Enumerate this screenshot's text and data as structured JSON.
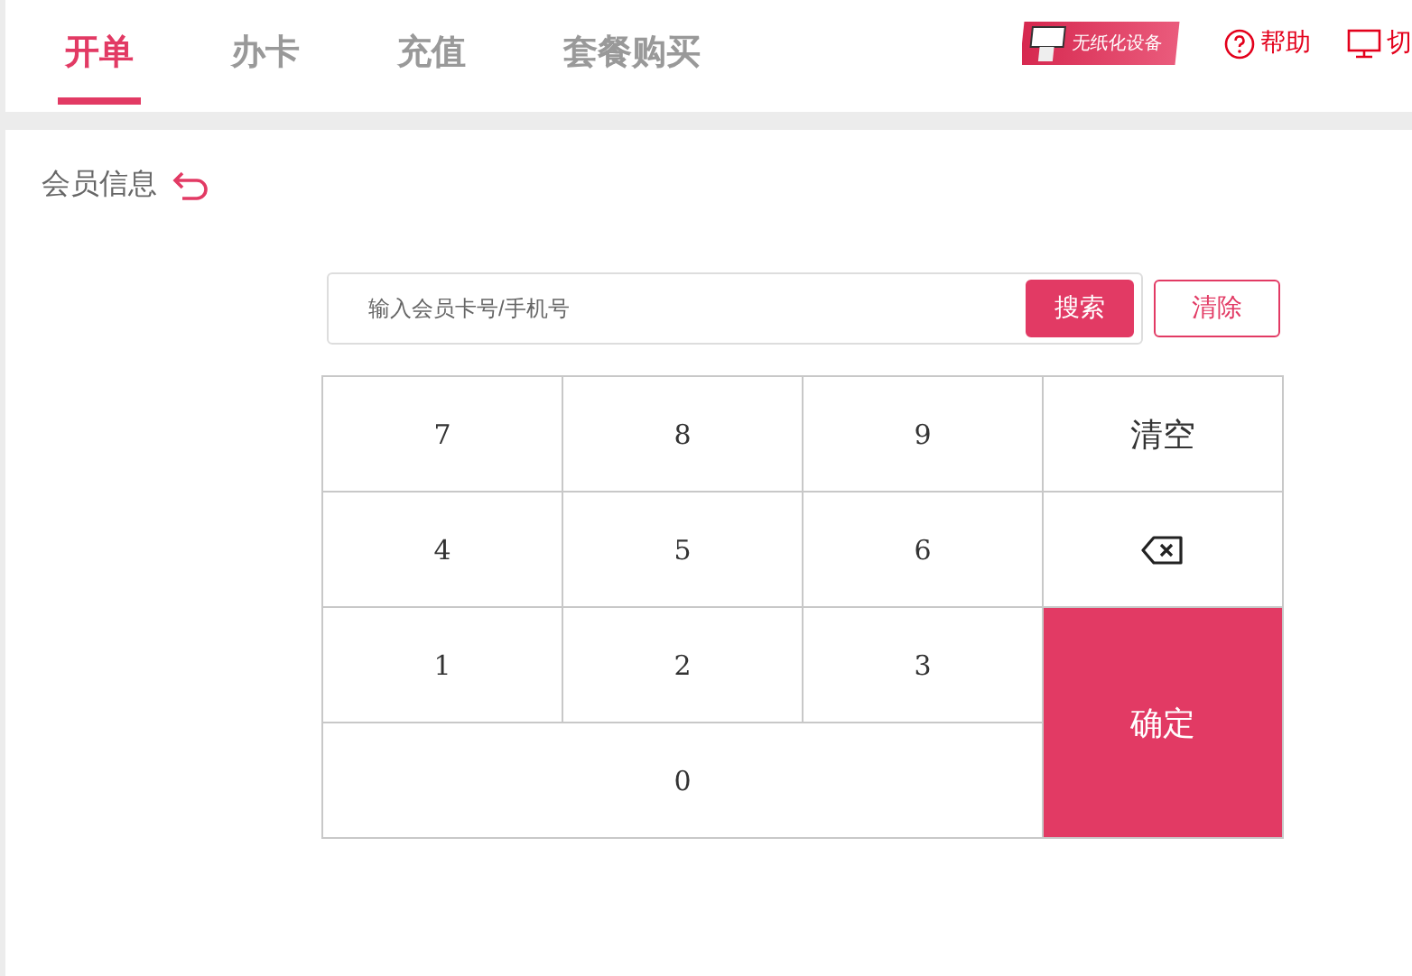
{
  "tabs": [
    {
      "label": "开单",
      "selected": true
    },
    {
      "label": "办卡",
      "selected": false
    },
    {
      "label": "充值",
      "selected": false
    },
    {
      "label": "套餐购买",
      "selected": false
    }
  ],
  "header_actions": {
    "device_badge": "无纸化设备",
    "help": "帮助",
    "switch": "切"
  },
  "section_title": "会员信息",
  "search": {
    "placeholder": "输入会员卡号/手机号",
    "search_button": "搜索",
    "clear_button": "清除"
  },
  "keypad": [
    {
      "kind": "digit",
      "label": "7"
    },
    {
      "kind": "digit",
      "label": "8"
    },
    {
      "kind": "digit",
      "label": "9"
    },
    {
      "kind": "clear",
      "label": "清空"
    },
    {
      "kind": "digit",
      "label": "4"
    },
    {
      "kind": "digit",
      "label": "5"
    },
    {
      "kind": "digit",
      "label": "6"
    },
    {
      "kind": "backspace"
    },
    {
      "kind": "digit",
      "label": "1"
    },
    {
      "kind": "digit",
      "label": "2"
    },
    {
      "kind": "digit",
      "label": "3"
    },
    {
      "kind": "confirm",
      "label": "确定"
    },
    {
      "kind": "zero",
      "label": "0"
    }
  ]
}
